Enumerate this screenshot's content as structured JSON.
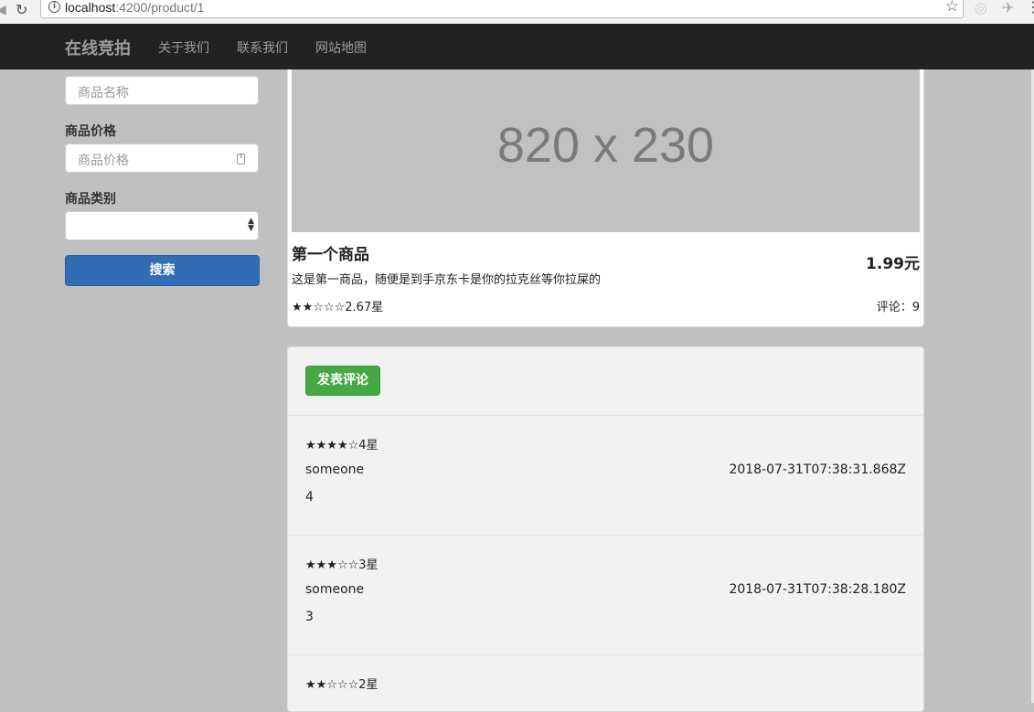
{
  "browser": {
    "url_host": "localhost",
    "url_path": ":4200/product/1"
  },
  "navbar": {
    "brand": "在线竞拍",
    "links": [
      "关于我们",
      "联系我们",
      "网站地图"
    ]
  },
  "search_form": {
    "name_placeholder": "商品名称",
    "price_label": "商品价格",
    "price_placeholder": "商品价格",
    "category_label": "商品类别",
    "category_value": "",
    "search_button": "搜索"
  },
  "product": {
    "image_placeholder": "820 x 230",
    "title": "第一个商品",
    "price": "1.99元",
    "description": "这是第一商品，随便是到手京东卡是你的拉克丝等你拉屎的",
    "rating": "★★☆☆☆2.67星",
    "comment_count": "评论：9"
  },
  "comments": {
    "add_button": "发表评论",
    "items": [
      {
        "stars": "★★★★☆4星",
        "user": "someone",
        "timestamp": "2018-07-31T07:38:31.868Z",
        "content": "4"
      },
      {
        "stars": "★★★☆☆3星",
        "user": "someone",
        "timestamp": "2018-07-31T07:38:28.180Z",
        "content": "3"
      },
      {
        "stars": "★★☆☆☆2星"
      }
    ]
  }
}
